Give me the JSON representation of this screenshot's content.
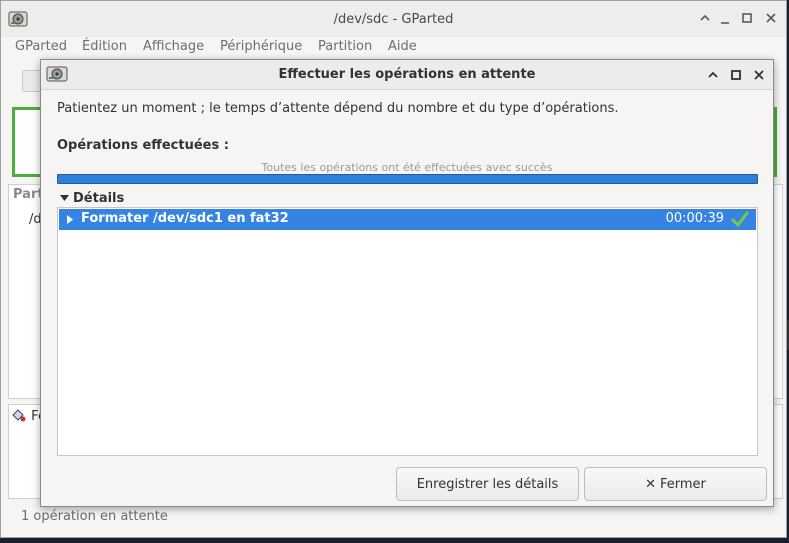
{
  "main_window": {
    "title": "/dev/sdc - GParted",
    "menu": [
      "GParted",
      "Édition",
      "Affichage",
      "Périphérique",
      "Partition",
      "Aide"
    ],
    "partition_list_header": "Part",
    "partition_row_path": "/d",
    "pending_row_label": "Fo",
    "status": "1 opération en attente"
  },
  "dialog": {
    "title": "Effectuer les opérations en attente",
    "message": "Patientez un moment ; le temps d’attente dépend du nombre et du type d’opérations.",
    "ops_label": "Opérations effectuées :",
    "progress_text": "Toutes les opérations ont été effectuées avec succès",
    "progress_fraction": 1.0,
    "details_label": "Détails",
    "operations": [
      {
        "label": "Formater /dev/sdc1 en fat32",
        "time": "00:00:39",
        "status_icon": "check-icon"
      }
    ],
    "buttons": {
      "save": "Enregistrer les détails",
      "close": "Fermer"
    }
  },
  "colors": {
    "selection": "#3584e4",
    "progress": "#2f7ed8",
    "graph_border": "#4cae3c",
    "check": "#7ac943"
  }
}
